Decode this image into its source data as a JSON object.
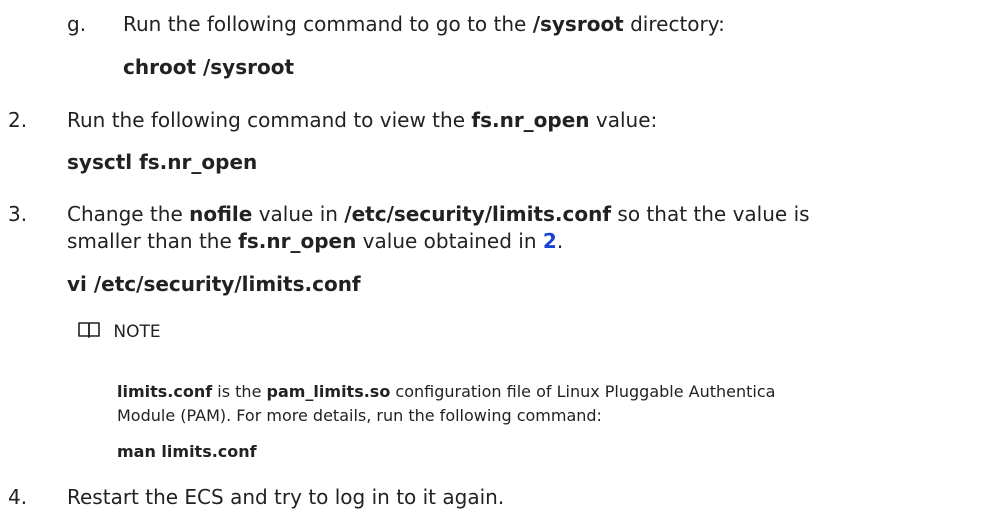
{
  "step_g": {
    "marker": "g.",
    "text_before": "Run the following command to go to the ",
    "path": "/sysroot",
    "text_after": " directory:",
    "command": "chroot /sysroot"
  },
  "step_2": {
    "marker": "2.",
    "text_before": "Run the following command to view the ",
    "param": "fs.nr_open",
    "text_after": " value:",
    "command": "sysctl fs.nr_open"
  },
  "step_3": {
    "marker": "3.",
    "line1_before": "Change the ",
    "nofile": "nofile",
    "line1_mid": " value in ",
    "file": "/etc/security/limits.conf",
    "line1_after": " so that the value is",
    "line2_before": "smaller than the ",
    "param": "fs.nr_open",
    "line2_mid": " value obtained in ",
    "ref": "2",
    "line2_after": ".",
    "command": "vi /etc/security/limits.conf"
  },
  "note": {
    "icon": "book-icon",
    "label": "NOTE",
    "file": "limits.conf",
    "text1": " is the ",
    "module": "pam_limits.so",
    "text2": " configuration file of Linux Pluggable Authentica",
    "line2": "Module (PAM). For more details, run the following command:",
    "command": "man limits.conf"
  },
  "step_4": {
    "marker": "4.",
    "text": "Restart the ECS and try to log in to it again."
  }
}
